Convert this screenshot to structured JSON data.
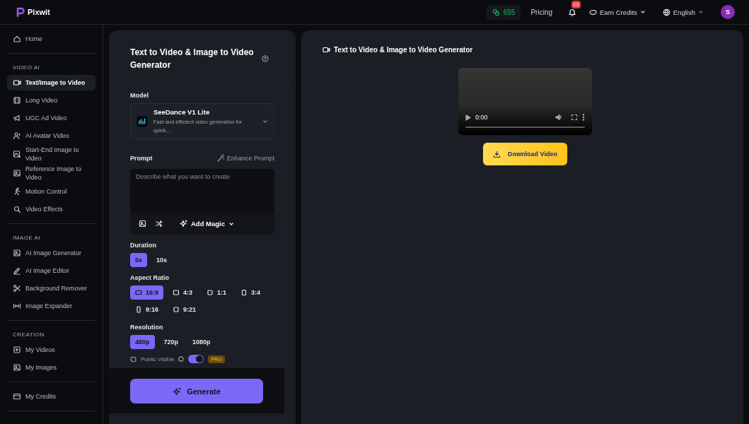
{
  "header": {
    "logo": "Pixwit",
    "credits": "655",
    "nav_link": "Pricing",
    "notifications": {
      "count": "25"
    },
    "earn_credits": "Earn Credits",
    "language": "English",
    "avatar": "S"
  },
  "sidebar": {
    "sections": [
      {
        "items": [
          {
            "label": "Home",
            "selected": false
          }
        ]
      },
      {
        "heading": "VIDEO AI",
        "items": [
          {
            "label": "Text/Image to Video",
            "selected": true
          },
          {
            "label": "Long Video",
            "selected": false
          },
          {
            "label": "UGC Ad Video",
            "selected": false
          },
          {
            "label": "AI Avatar Video",
            "selected": false
          },
          {
            "label": "Start-End Image to Video",
            "selected": false
          },
          {
            "label": "Reference Image to Video",
            "selected": false
          },
          {
            "label": "Motion Control",
            "selected": false
          },
          {
            "label": "Video Effects",
            "selected": false
          }
        ]
      },
      {
        "heading": "IMAGE AI",
        "items": [
          {
            "label": "AI Image Generator",
            "selected": false
          },
          {
            "label": "AI Image Editor",
            "selected": false
          },
          {
            "label": "Background Remover",
            "selected": false
          },
          {
            "label": "Image Expander",
            "selected": false
          }
        ]
      },
      {
        "heading": "CREATION",
        "items": [
          {
            "label": "My Videos",
            "selected": false
          },
          {
            "label": "My Images",
            "selected": false
          }
        ]
      },
      {
        "items": [
          {
            "label": "My Credits",
            "selected": false
          }
        ]
      }
    ]
  },
  "form": {
    "title": "Text to Video & Image to Video Generator",
    "model_label": "Model",
    "model": {
      "name": "SeeDance V1 Lite",
      "description": "Fast and efficient video generation for quick..."
    },
    "prompt_label": "Prompt",
    "enhance_button": "Enhance Prompt",
    "prompt": {
      "placeholder": "Describe what you want to create"
    },
    "add_magic": "Add Magic",
    "duration_label": "Duration",
    "durations": [
      {
        "label": "5s",
        "selected": true
      },
      {
        "label": "10s",
        "selected": false
      }
    ],
    "aspect_label": "Aspect Ratio",
    "aspects": [
      {
        "label": "16:9",
        "selected": true
      },
      {
        "label": "4:3",
        "selected": false
      },
      {
        "label": "1:1",
        "selected": false
      },
      {
        "label": "3:4",
        "selected": false
      },
      {
        "label": "9:16",
        "selected": false
      },
      {
        "label": "9:21",
        "selected": false
      }
    ],
    "resolution_label": "Resolution",
    "resolutions": [
      {
        "label": "480p",
        "selected": true
      },
      {
        "label": "720p",
        "selected": false
      },
      {
        "label": "1080p",
        "selected": false
      }
    ],
    "public": {
      "label": "Public Visible",
      "on": true,
      "badge": "PRO"
    },
    "generate_button": "Generate"
  },
  "result": {
    "title": "Text to Video & Image to Video Generator",
    "player": {
      "time": "0:00"
    },
    "download_button": "Download Video"
  }
}
